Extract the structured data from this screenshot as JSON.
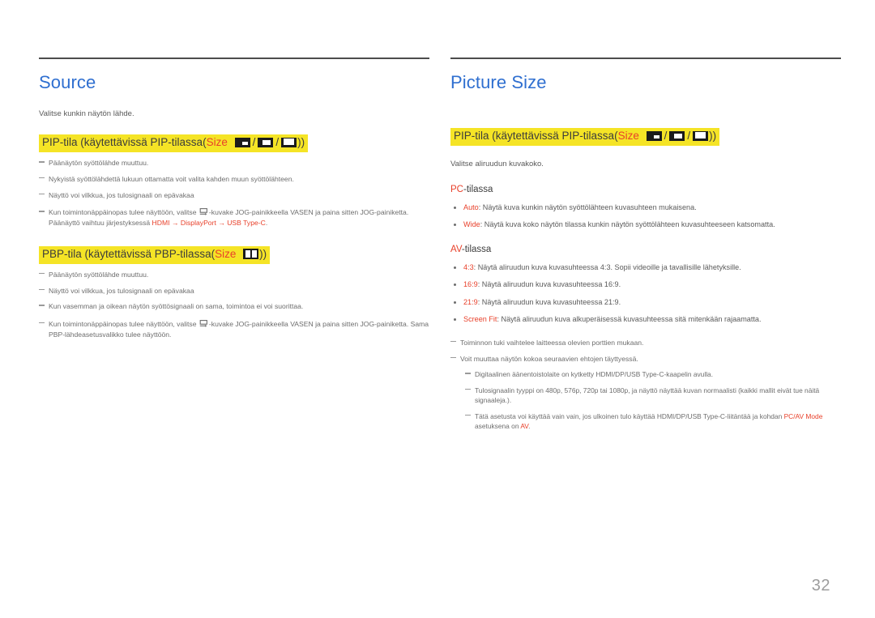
{
  "page": {
    "number": "32"
  },
  "left": {
    "title": "Source",
    "intro": "Valitse kunkin näytön lähde.",
    "pip_heading": {
      "before": "PIP-tila (käytettävissä PIP-tilassa(",
      "keyword": "Size",
      "after": "))"
    },
    "pip_notes": [
      "Päänäytön syöttölähde muuttuu.",
      "Nykyistä syöttölähdettä lukuun ottamatta voit valita kahden muun syöttölähteen.",
      "Näyttö voi vilkkua, jos tulosignaali on epävakaa"
    ],
    "pip_jog_note": {
      "part1": "Kun toimintonäppäinopas tulee näyttöön, valitse ",
      "part2": "-kuvake JOG-painikkeella VASEN ja paina sitten JOG-painiketta. Päänäyttö vaihtuu järjestyksessä ",
      "kw1": "HDMI",
      "arrow1": " → ",
      "kw2": "DisplayPort",
      "arrow2": " → ",
      "kw3": "USB Type-C",
      "part3": "."
    },
    "pbp_heading": {
      "before": "PBP-tila (käytettävissä PBP-tilassa(",
      "keyword": "Size",
      "after": "))"
    },
    "pbp_notes": [
      "Päänäytön syöttölähde muuttuu.",
      "Näyttö voi vilkkua, jos tulosignaali on epävakaa",
      "Kun vasemman ja oikean näytön syöttösignaali on sama, toimintoa ei voi suorittaa."
    ],
    "pbp_jog_note": {
      "part1": "Kun toimintonäppäinopas tulee näyttöön, valitse ",
      "part2": "-kuvake JOG-painikkeella VASEN ja paina sitten JOG-painiketta. Sama PBP-lähdeasetusvalikko tulee näyttöön."
    }
  },
  "right": {
    "title": "Picture Size",
    "pip_heading": {
      "before": "PIP-tila (käytettävissä PIP-tilassa(",
      "keyword": "Size",
      "after": "))"
    },
    "intro": "Valitse aliruudun kuvakoko.",
    "pc_mode": {
      "keyword": "PC",
      "suffix": "-tilassa"
    },
    "pc_items": [
      {
        "kw": "Auto",
        "text": ": Näytä kuva kunkin näytön syöttölähteen kuvasuhteen mukaisena."
      },
      {
        "kw": "Wide",
        "text": ": Näytä kuva koko näytön tilassa kunkin näytön syöttölähteen kuvasuhteeseen katsomatta."
      }
    ],
    "av_mode": {
      "keyword": "AV",
      "suffix": "-tilassa"
    },
    "av_items": [
      {
        "kw": "4:3",
        "text": ": Näytä aliruudun kuva kuvasuhteessa 4:3. Sopii videoille ja tavallisille lähetyksille."
      },
      {
        "kw": "16:9",
        "text": ": Näytä aliruudun kuva kuvasuhteessa 16:9."
      },
      {
        "kw": "21:9",
        "text": ": Näytä aliruudun kuva kuvasuhteessa 21:9."
      },
      {
        "kw": "Screen Fit",
        "text": ": Näytä aliruudun kuva alkuperäisessä kuvasuhteessa sitä mitenkään rajaamatta."
      }
    ],
    "notes": [
      "Toiminnon tuki vaihtelee laitteessa olevien porttien mukaan.",
      "Voit muuttaa näytön kokoa seuraavien ehtojen täyttyessä."
    ],
    "sub_notes": [
      "Digitaalinen äänentoistolaite on kytketty HDMI/DP/USB Type-C-kaapelin avulla.",
      "Tulosignaalin tyyppi on 480p, 576p, 720p tai 1080p, ja näyttö näyttää kuvan normaalisti (kaikki mallit eivät tue näitä signaaleja.)."
    ],
    "last_note": {
      "part1": "Tätä asetusta voi käyttää vain vain, jos ulkoinen tulo käyttää HDMI/DP/USB Type-C-liitäntää ja kohdan ",
      "kw1": "PC/AV Mode",
      "part2": " asetuksena on ",
      "kw2": "AV",
      "part3": "."
    }
  },
  "icons": {
    "pip_small": "pip-size-small-icon",
    "pip_medium": "pip-size-medium-icon",
    "pip_large": "pip-size-large-icon",
    "pbp": "pbp-split-screen-icon",
    "jog": "jog-source-icon"
  },
  "colors": {
    "heading_blue": "#2f6fd0",
    "accent_red": "#e8402a",
    "highlight_yellow": "#f5e426",
    "body_gray": "#5a5a5a",
    "page_number_gray": "#9d9d9d"
  }
}
